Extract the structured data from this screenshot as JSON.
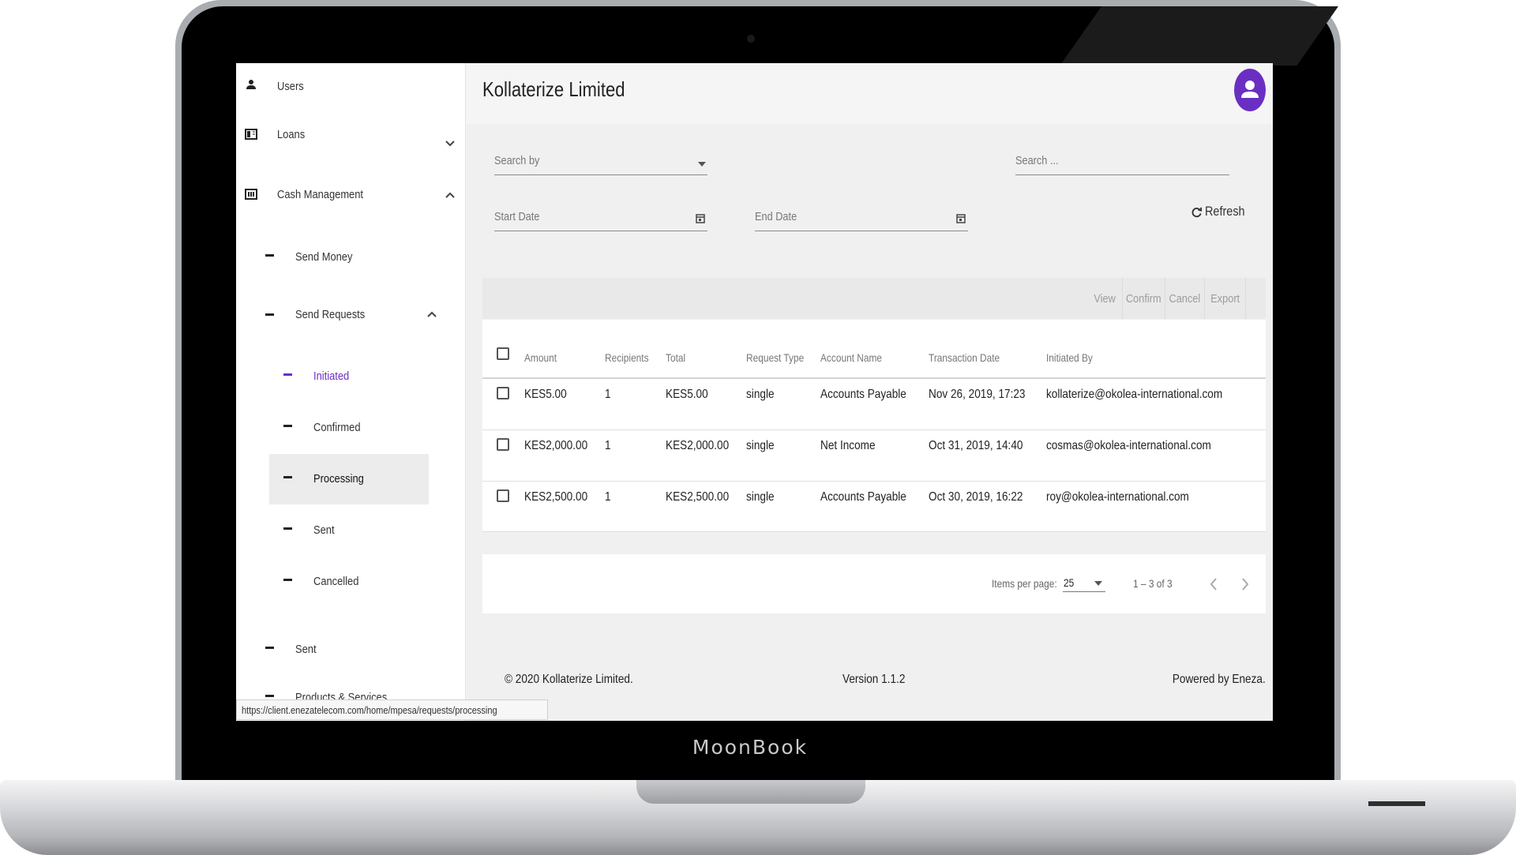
{
  "device": {
    "brand": "MoonBook"
  },
  "app": {
    "company_title": "Kollaterize Limited"
  },
  "sidebar": {
    "users": "Users",
    "loans": "Loans",
    "cash_management": "Cash Management",
    "send_money": "Send Money",
    "send_requests": "Send Requests",
    "initiated": "Initiated",
    "confirmed": "Confirmed",
    "processing": "Processing",
    "sent_sub": "Sent",
    "cancelled": "Cancelled",
    "sent": "Sent",
    "products_services": "Products & Services"
  },
  "filters": {
    "search_by": "Search by",
    "search_placeholder": "Search ...",
    "start_date": "Start Date",
    "end_date": "End Date",
    "refresh": "Refresh"
  },
  "toolbar": {
    "view": "View",
    "confirm": "Confirm",
    "cancel": "Cancel",
    "export": "Export"
  },
  "table": {
    "headers": {
      "amount": "Amount",
      "recipients": "Recipients",
      "total": "Total",
      "request_type": "Request Type",
      "account_name": "Account Name",
      "transaction_date": "Transaction Date",
      "initiated_by": "Initiated By"
    },
    "rows": [
      {
        "amount": "KES5.00",
        "recipients": "1",
        "total": "KES5.00",
        "request_type": "single",
        "account_name": "Accounts Payable",
        "transaction_date": "Nov 26, 2019, 17:23",
        "initiated_by": "kollaterize@okolea-international.com"
      },
      {
        "amount": "KES2,000.00",
        "recipients": "1",
        "total": "KES2,000.00",
        "request_type": "single",
        "account_name": "Net Income",
        "transaction_date": "Oct 31, 2019, 14:40",
        "initiated_by": "cosmas@okolea-international.com"
      },
      {
        "amount": "KES2,500.00",
        "recipients": "1",
        "total": "KES2,500.00",
        "request_type": "single",
        "account_name": "Accounts Payable",
        "transaction_date": "Oct 30, 2019, 16:22",
        "initiated_by": "roy@okolea-international.com"
      }
    ]
  },
  "paginator": {
    "items_per_page_label": "Items per page:",
    "items_per_page": "25",
    "range": "1 – 3 of 3"
  },
  "footer": {
    "copyright": "© 2020 Kollaterize Limited.",
    "version": "Version 1.1.2",
    "powered_by": "Powered by Eneza."
  },
  "status_bar": {
    "url": "https://client.enezatelecom.com/home/mpesa/requests/processing"
  },
  "colors": {
    "accent": "#6a2fc2",
    "avatar_bg": "#6a2fc2"
  },
  "icons": {
    "users": "person-icon",
    "loans": "book-icon",
    "cash_management": "cash-icon",
    "expand": "chevron-down-icon",
    "collapse": "chevron-up-icon",
    "calendar": "calendar-icon",
    "refresh": "refresh-icon",
    "avatar": "account-icon"
  }
}
